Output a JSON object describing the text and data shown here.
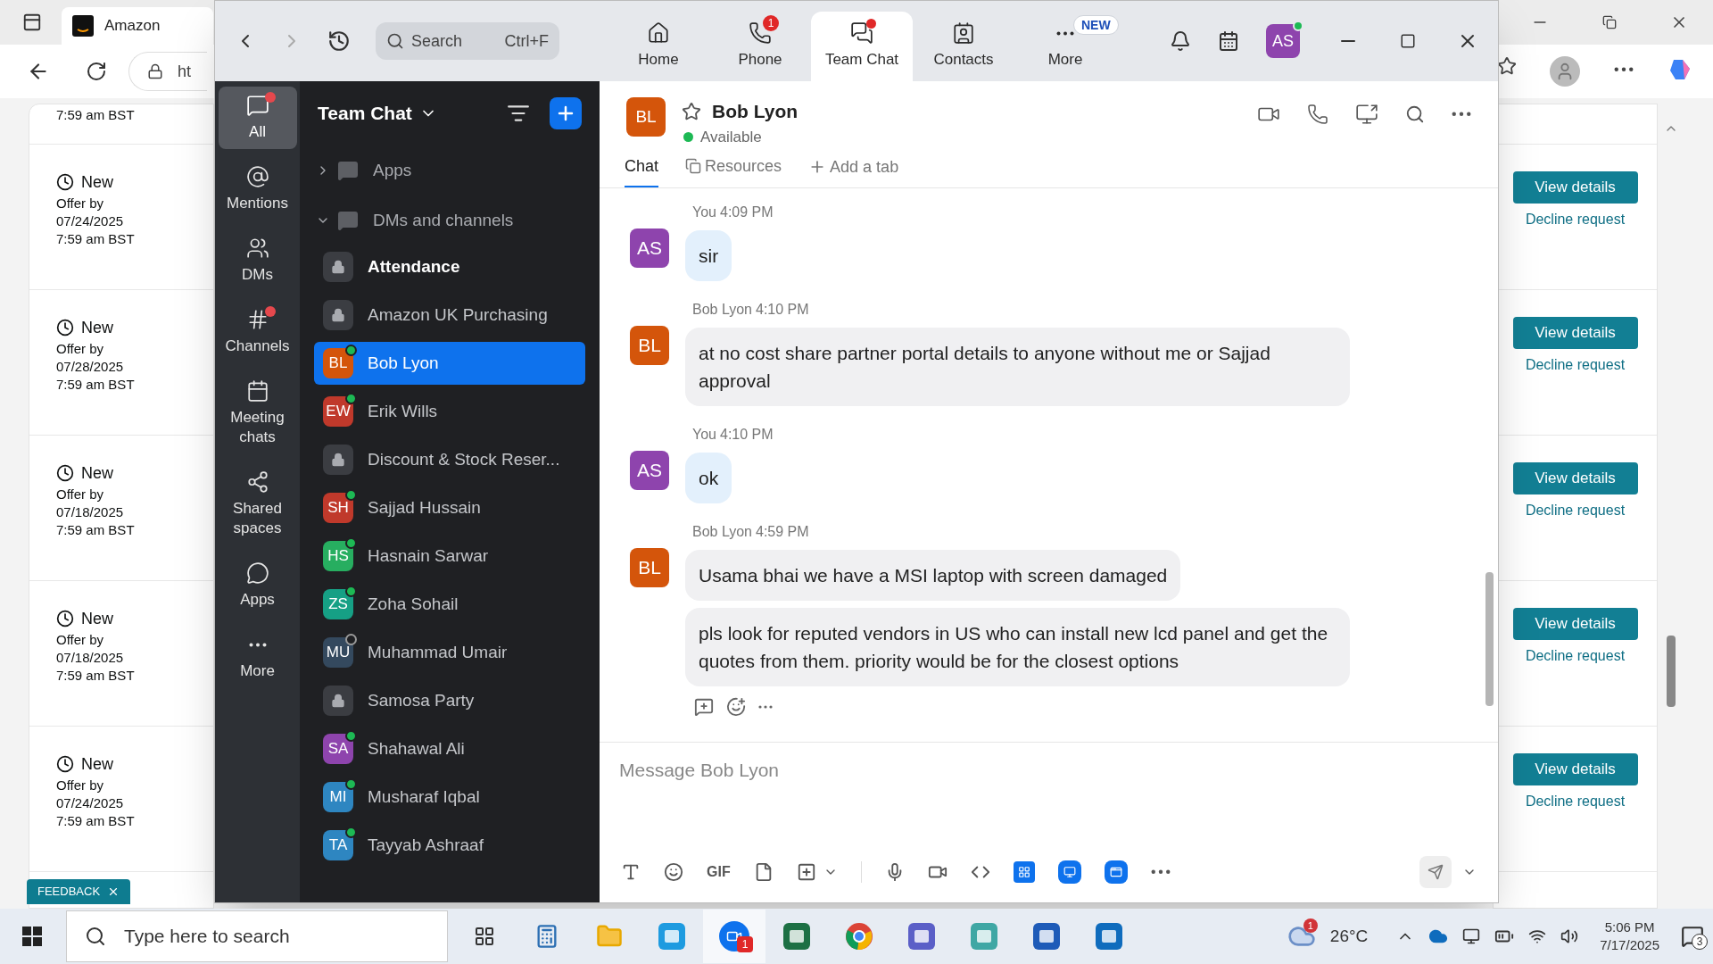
{
  "browser": {
    "tab_title": "Amazon",
    "url": "ht"
  },
  "offers": {
    "top_partial_time": "7:59 am BST",
    "cards": [
      {
        "status": "New",
        "offer_label": "Offer by",
        "date": "07/24/2025",
        "time": "7:59 am BST",
        "action": "View details",
        "decline": "Decline request"
      },
      {
        "status": "New",
        "offer_label": "Offer by",
        "date": "07/28/2025",
        "time": "7:59 am BST",
        "action": "View details",
        "decline": "Decline request"
      },
      {
        "status": "New",
        "offer_label": "Offer by",
        "date": "07/18/2025",
        "time": "7:59 am BST",
        "action": "View details",
        "decline": "Decline request"
      },
      {
        "status": "New",
        "offer_label": "Offer by",
        "date": "07/18/2025",
        "time": "7:59 am BST",
        "action": "View details",
        "decline": "Decline request"
      },
      {
        "status": "New",
        "offer_label": "Offer by",
        "date": "07/24/2025",
        "time": "7:59 am BST",
        "action": "View details",
        "decline": "Decline request"
      }
    ],
    "feedback": "FEEDBACK"
  },
  "zoom": {
    "search": {
      "placeholder": "Search",
      "shortcut": "Ctrl+F"
    },
    "nav_tabs": [
      {
        "label": "Home",
        "selected": false
      },
      {
        "label": "Phone",
        "selected": false,
        "badge": "1"
      },
      {
        "label": "Team Chat",
        "selected": true,
        "unread": true
      },
      {
        "label": "Contacts",
        "selected": false
      },
      {
        "label": "More",
        "selected": false,
        "tag": "NEW"
      }
    ],
    "profile": {
      "initials": "AS",
      "color": "#8e44ad",
      "online": true
    },
    "rail": [
      {
        "label": "All",
        "selected": true,
        "unread": true
      },
      {
        "label": "Mentions",
        "selected": false,
        "unread": false
      },
      {
        "label": "DMs",
        "selected": false,
        "unread": false
      },
      {
        "label": "Channels",
        "selected": false,
        "unread": true
      },
      {
        "label": "Meeting chats",
        "selected": false,
        "unread": false
      },
      {
        "label": "Shared spaces",
        "selected": false,
        "unread": false
      },
      {
        "label": "Apps",
        "selected": false,
        "unread": false
      },
      {
        "label": "More",
        "selected": false,
        "unread": false
      }
    ],
    "sidebar": {
      "title": "Team Chat",
      "sections": [
        {
          "label": "Apps",
          "expanded": false
        },
        {
          "label": "DMs and channels",
          "expanded": true
        }
      ],
      "items": [
        {
          "name": "Attendance",
          "kind": "channel",
          "unread": true,
          "selected": false
        },
        {
          "name": "Amazon UK Purchasing",
          "kind": "channel",
          "unread": false,
          "selected": false
        },
        {
          "name": "Bob Lyon",
          "kind": "person",
          "initials": "BL",
          "color": "#d4550b",
          "online": true,
          "unread": false,
          "selected": true
        },
        {
          "name": "Erik Wills",
          "kind": "person",
          "initials": "EW",
          "color": "#c0392b",
          "online": true,
          "unread": false,
          "selected": false
        },
        {
          "name": "Discount & Stock Reser...",
          "kind": "channel",
          "unread": false,
          "selected": false
        },
        {
          "name": "Sajjad Hussain",
          "kind": "person",
          "initials": "SH",
          "color": "#c0392b",
          "online": true,
          "unread": false,
          "selected": false
        },
        {
          "name": "Hasnain Sarwar",
          "kind": "person",
          "initials": "HS",
          "color": "#27ae60",
          "online": true,
          "unread": false,
          "selected": false
        },
        {
          "name": "Zoha Sohail",
          "kind": "person",
          "initials": "ZS",
          "color": "#16a085",
          "online": true,
          "unread": false,
          "selected": false
        },
        {
          "name": "Muhammad Umair",
          "kind": "person",
          "initials": "MU",
          "color": "#34495e",
          "online": false,
          "unread": false,
          "selected": false
        },
        {
          "name": "Samosa Party",
          "kind": "channel",
          "unread": false,
          "selected": false
        },
        {
          "name": "Shahawal Ali",
          "kind": "person",
          "initials": "SA",
          "color": "#8e44ad",
          "online": true,
          "unread": false,
          "selected": false
        },
        {
          "name": "Musharaf Iqbal",
          "kind": "person",
          "initials": "MI",
          "color": "#2e86c1",
          "online": true,
          "unread": false,
          "selected": false
        },
        {
          "name": "Tayyab Ashraaf",
          "kind": "person",
          "initials": "TA",
          "color": "#2e86c1",
          "online": true,
          "unread": false,
          "selected": false
        }
      ]
    },
    "chat": {
      "initials": "BL",
      "color": "#d4550b",
      "name": "Bob Lyon",
      "starred": false,
      "status": "Available",
      "online": true,
      "tabs": [
        {
          "label": "Chat",
          "selected": true
        },
        {
          "label": "Resources",
          "selected": false
        }
      ],
      "add_tab": "Add a tab",
      "messages": [
        {
          "sender": "You",
          "time": "4:09 PM",
          "initials": "AS",
          "color": "#8e44ad",
          "mine": true,
          "bubbles": [
            "sir"
          ]
        },
        {
          "sender": "Bob Lyon",
          "time": "4:10 PM",
          "initials": "BL",
          "color": "#d4550b",
          "mine": false,
          "bubbles": [
            "at no cost share partner portal details to anyone without me or Sajjad approval"
          ]
        },
        {
          "sender": "You",
          "time": "4:10 PM",
          "initials": "AS",
          "color": "#8e44ad",
          "mine": true,
          "bubbles": [
            "ok"
          ]
        },
        {
          "sender": "Bob Lyon",
          "time": "4:59 PM",
          "initials": "BL",
          "color": "#d4550b",
          "mine": false,
          "bubbles": [
            "Usama bhai we have a MSI laptop with screen damaged",
            "pls look for reputed vendors in US who can install new lcd panel and get the quotes from them. priority would be for the closest options"
          ]
        }
      ],
      "composer": {
        "placeholder": "Message Bob Lyon",
        "gif": "GIF"
      }
    }
  },
  "taskbar": {
    "search_placeholder": "Type here to search",
    "zoom_badge": "1",
    "weather_badge": "1",
    "temperature": "26°C",
    "time": "5:06 PM",
    "date": "7/17/2025",
    "notifications": "3"
  }
}
